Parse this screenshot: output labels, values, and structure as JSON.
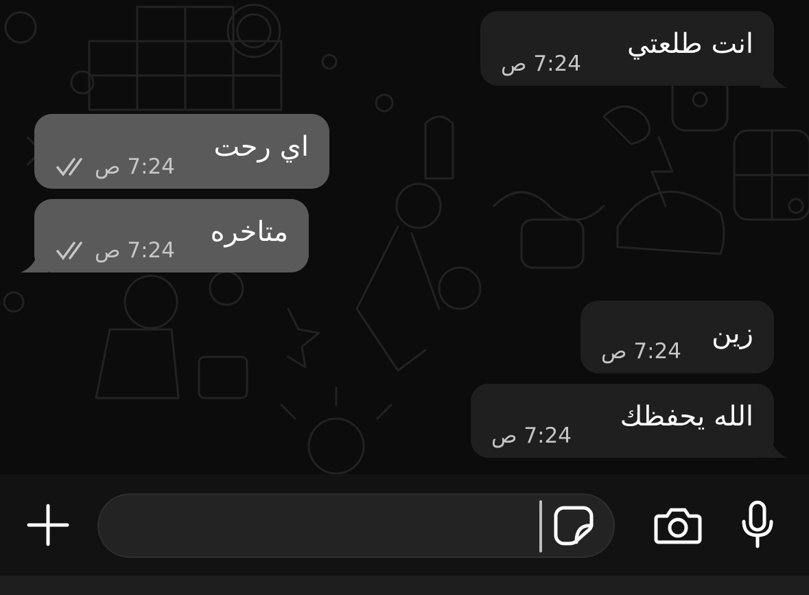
{
  "messages": [
    {
      "direction": "incoming",
      "text": "انت طلعتي",
      "time": "7:24 ص",
      "read_ticks": false
    },
    {
      "direction": "outgoing",
      "text": "اي رحت",
      "time": "7:24 ص",
      "read_ticks": true
    },
    {
      "direction": "outgoing",
      "text": "متاخره",
      "time": "7:24 ص",
      "read_ticks": true
    },
    {
      "direction": "incoming",
      "text": "زين",
      "time": "7:24 ص",
      "read_ticks": false
    },
    {
      "direction": "incoming",
      "text": "الله يحفظك",
      "time": "7:24 ص",
      "read_ticks": false
    }
  ],
  "composer": {
    "input_value": "",
    "icons": [
      "plus-icon",
      "sticker-icon",
      "camera-icon",
      "microphone-icon"
    ]
  },
  "colors": {
    "background": "#0c0c0c",
    "incoming_bubble": "#1f1f1f",
    "outgoing_bubble": "#5a5a5a",
    "meta_text": "#c6c6c6"
  }
}
